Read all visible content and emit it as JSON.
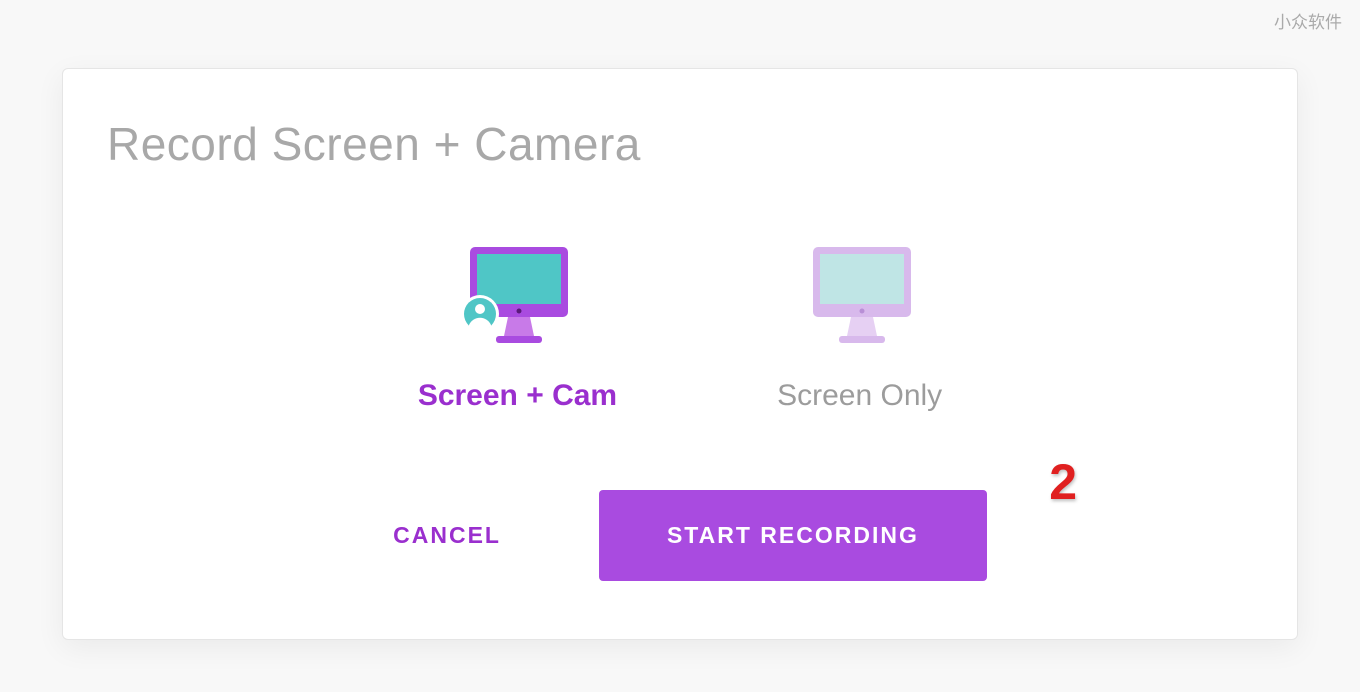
{
  "watermark": "小众软件",
  "dialog": {
    "title": "Record Screen + Camera",
    "options": [
      {
        "label": "Screen + Cam",
        "selected": true
      },
      {
        "label": "Screen Only",
        "selected": false
      }
    ],
    "cancel_label": "CANCEL",
    "start_label": "START RECORDING"
  },
  "annotation": {
    "step_number": "2"
  },
  "colors": {
    "accent": "#9a2fce",
    "button_bg": "#a94be0",
    "title_gray": "#a8a8a8",
    "annotation_red": "#e02020"
  }
}
